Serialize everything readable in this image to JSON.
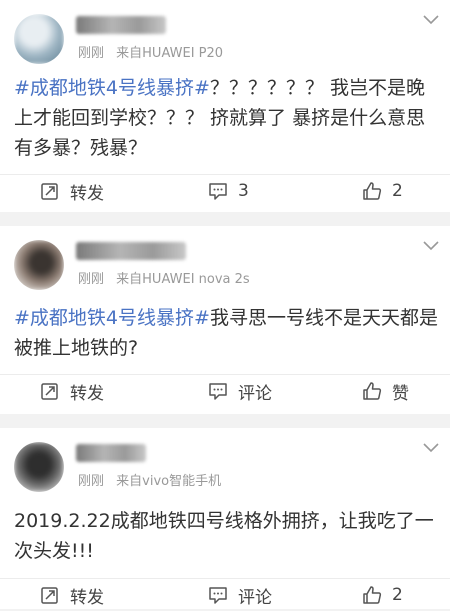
{
  "posts": [
    {
      "meta_time": "刚刚",
      "meta_source": "来自HUAWEI P20",
      "topic": "#成都地铁4号线暴挤#",
      "text": "？？？？？？ 我岂不是晚上才能回到学校？？？ 挤就算了 暴挤是什么意思 有多暴？残暴？",
      "repost_label": "转发",
      "comment_label": "3",
      "like_label": "2"
    },
    {
      "meta_time": "刚刚",
      "meta_source": "来自HUAWEI nova 2s",
      "topic": "#成都地铁4号线暴挤#",
      "text": "我寻思一号线不是天天都是被推上地铁的?",
      "repost_label": "转发",
      "comment_label": "评论",
      "like_label": "赞"
    },
    {
      "meta_time": "刚刚",
      "meta_source": "来自vivo智能手机",
      "topic": "",
      "text": "2019.2.22成都地铁四号线格外拥挤，让我吃了一次头发!!!",
      "repost_label": "转发",
      "comment_label": "评论",
      "like_label": "2"
    }
  ],
  "icons": {
    "repost": "repost-icon",
    "comment": "comment-icon",
    "like": "thumbs-up-icon",
    "menu": "chevron-down-icon"
  },
  "colors": {
    "topic": "#4a73c4",
    "meta": "#999999",
    "text": "#333333",
    "separator": "#f2f2f2"
  }
}
